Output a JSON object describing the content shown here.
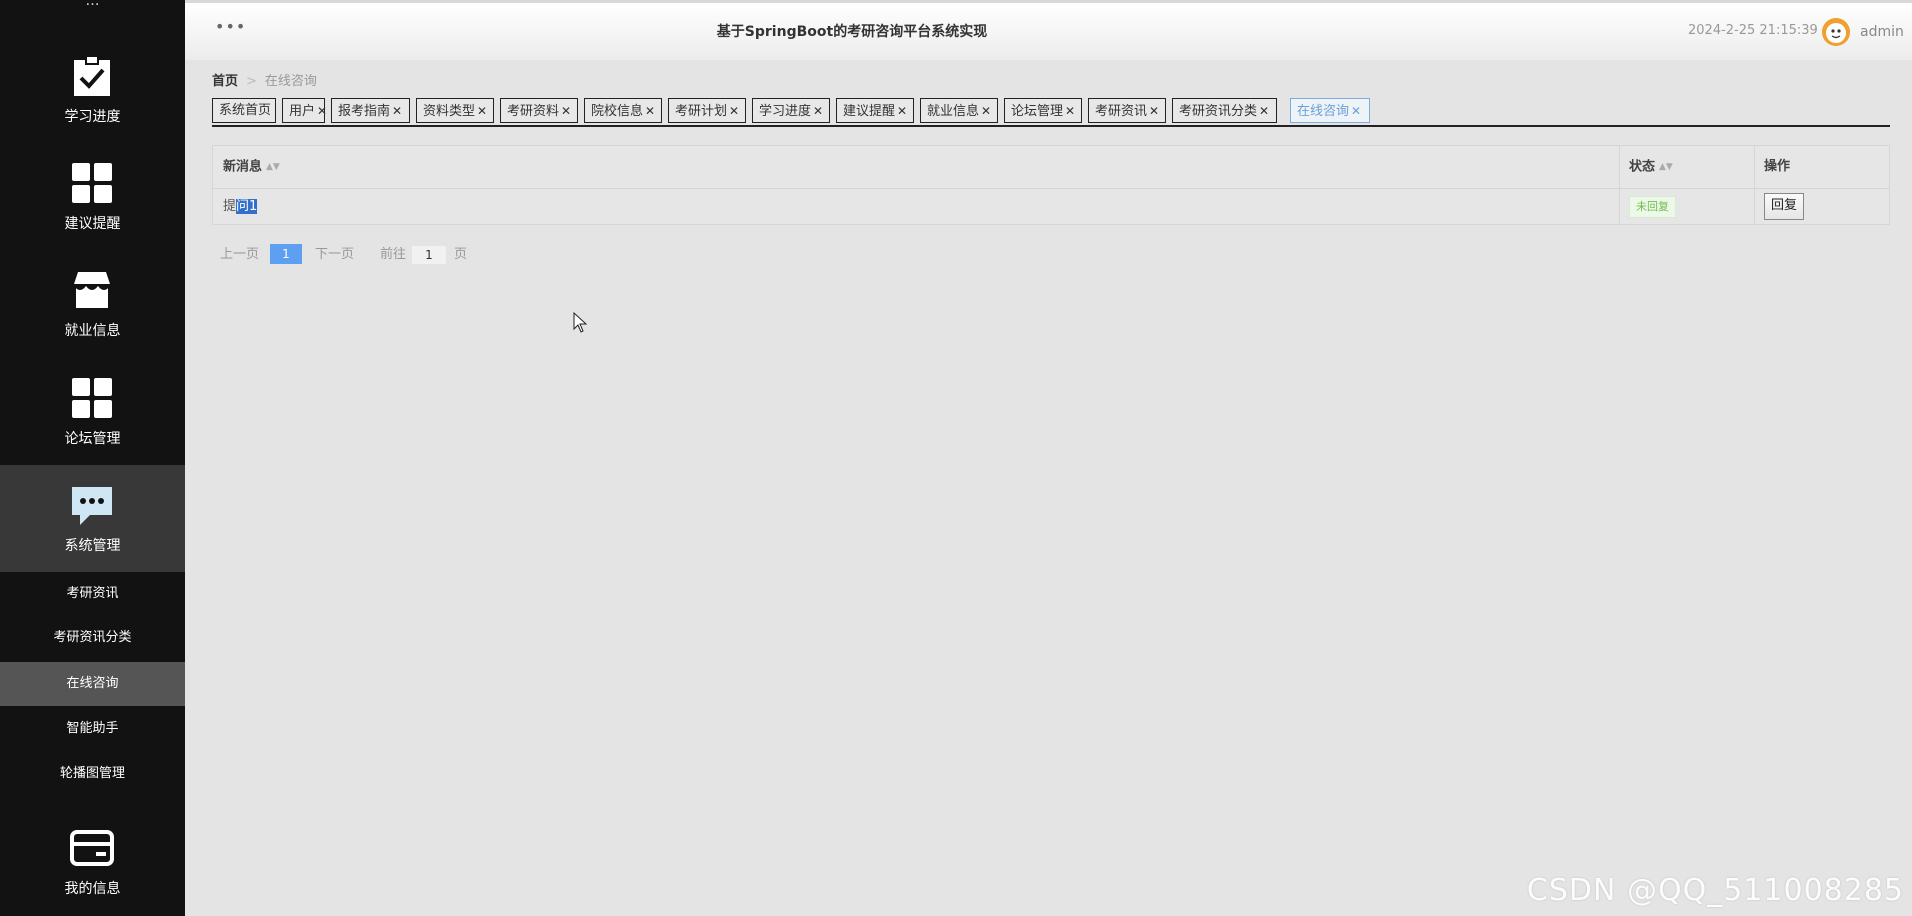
{
  "sidebar": {
    "top_cut_label": "",
    "items": [
      {
        "label": "学习进度",
        "icon": "clipboard-check-icon"
      },
      {
        "label": "建议提醒",
        "icon": "grid-icon"
      },
      {
        "label": "就业信息",
        "icon": "shop-icon"
      },
      {
        "label": "论坛管理",
        "icon": "grid-icon"
      },
      {
        "label": "系统管理",
        "icon": "chat-icon"
      }
    ],
    "subitems": [
      "考研资讯",
      "考研资讯分类",
      "在线咨询",
      "智能助手",
      "轮播图管理"
    ],
    "bottom_item": {
      "label": "我的信息",
      "icon": "card-icon"
    }
  },
  "header": {
    "menu_dots": "•••",
    "title": "基于SpringBoot的考研咨询平台系统实现",
    "datetime": "2024-2-25 21:15:39",
    "username": "admin"
  },
  "breadcrumb": {
    "home": "首页",
    "separator": ">",
    "current": "在线咨询"
  },
  "tabs": [
    {
      "label": "系统首页",
      "closable": false
    },
    {
      "label": "用户",
      "closable": true
    },
    {
      "label": "报考指南",
      "closable": true
    },
    {
      "label": "资料类型",
      "closable": true
    },
    {
      "label": "考研资料",
      "closable": true
    },
    {
      "label": "院校信息",
      "closable": true
    },
    {
      "label": "考研计划",
      "closable": true
    },
    {
      "label": "学习进度",
      "closable": true
    },
    {
      "label": "建议提醒",
      "closable": true
    },
    {
      "label": "就业信息",
      "closable": true
    },
    {
      "label": "论坛管理",
      "closable": true
    },
    {
      "label": "考研资讯",
      "closable": true
    },
    {
      "label": "考研资讯分类",
      "closable": true
    },
    {
      "label": "在线咨询",
      "closable": true,
      "active": true
    }
  ],
  "table": {
    "headers": {
      "message": "新消息",
      "status": "状态",
      "action": "操作"
    },
    "rows": [
      {
        "message_plain": "提",
        "message_selected": "问1",
        "status": "未回复",
        "action": "回复"
      }
    ]
  },
  "pagination": {
    "prev": "上一页",
    "current_page": "1",
    "next": "下一页",
    "goto_label": "前往",
    "goto_value": "1",
    "page_suffix": "页"
  },
  "watermark": "CSDN @QQ_511008285",
  "colors": {
    "sidebar_bg": "#121212",
    "active_page": "#5d9ff0",
    "status_green": "#6cc04a"
  }
}
